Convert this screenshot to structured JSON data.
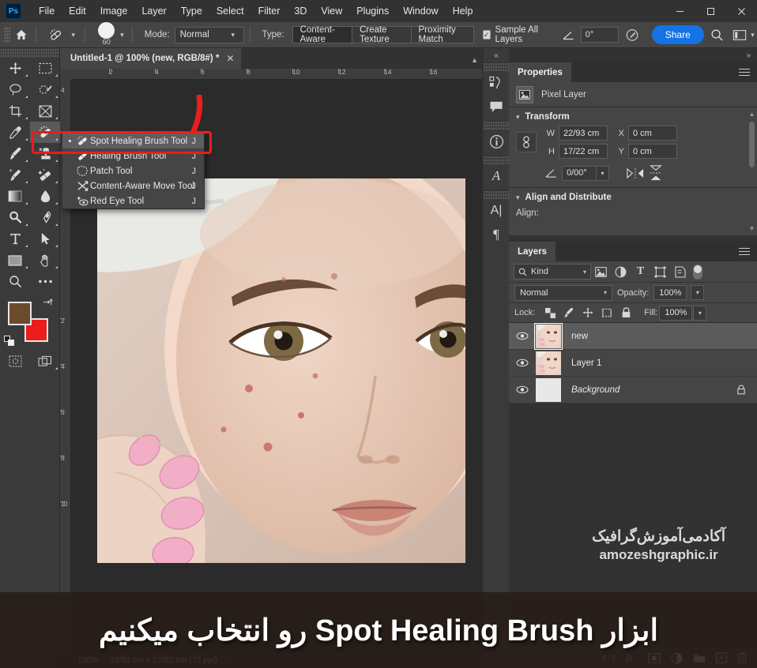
{
  "app": {
    "logo_text": "Ps"
  },
  "menubar": {
    "items": [
      "File",
      "Edit",
      "Image",
      "Layer",
      "Type",
      "Select",
      "Filter",
      "3D",
      "View",
      "Plugins",
      "Window",
      "Help"
    ]
  },
  "window_controls": {
    "minimize": "—",
    "maximize": "☐",
    "close": "✕"
  },
  "options_bar": {
    "home_icon": "home-icon",
    "tool_preset_icon": "spot-healing-brush-icon",
    "brush_size": "60",
    "mode_label": "Mode:",
    "mode_value": "Normal",
    "type_label": "Type:",
    "type_options": [
      "Content-Aware",
      "Create Texture",
      "Proximity Match"
    ],
    "type_active": "Content-Aware",
    "sample_all_layers_label": "Sample All Layers",
    "sample_all_layers_checked": true,
    "angle_value": "0°",
    "share_label": "Share",
    "search_icon": "search-icon",
    "workspace_icon": "workspace-icon"
  },
  "toolbar": {
    "tools": [
      "move-tool",
      "rectangular-marquee-tool",
      "lasso-tool",
      "object-selection-tool",
      "crop-tool",
      "frame-tool",
      "eyedropper-tool",
      "spot-healing-brush-tool",
      "brush-tool",
      "clone-stamp-tool",
      "history-brush-tool",
      "eraser-tool",
      "gradient-tool",
      "blur-tool",
      "dodge-tool",
      "pen-tool",
      "type-tool",
      "path-selection-tool",
      "rectangle-tool",
      "hand-tool",
      "zoom-tool",
      "more-tools"
    ],
    "selected_tool": "spot-healing-brush-tool",
    "foreground_color": "#6b4a2d",
    "background_color": "#ee1c1c",
    "bottom_tools": [
      "quick-mask-tool",
      "screen-mode-tool"
    ]
  },
  "flyout_menu": {
    "items": [
      {
        "label": "Spot Healing Brush Tool",
        "shortcut": "J",
        "icon": "spot-healing-brush-icon",
        "active": true,
        "bullet": "▪"
      },
      {
        "label": "Healing Brush Tool",
        "shortcut": "J",
        "icon": "healing-brush-icon",
        "active": false,
        "bullet": ""
      },
      {
        "label": "Patch Tool",
        "shortcut": "J",
        "icon": "patch-icon",
        "active": false,
        "bullet": ""
      },
      {
        "label": "Content-Aware Move Tool",
        "shortcut": "J",
        "icon": "content-aware-move-icon",
        "active": false,
        "bullet": ""
      },
      {
        "label": "Red Eye Tool",
        "shortcut": "J",
        "icon": "red-eye-icon",
        "active": false,
        "bullet": ""
      }
    ],
    "highlight_color": "#ef1b1b"
  },
  "document": {
    "tab_title": "Untitled-1 @ 100% (new, RGB/8#) *",
    "close_icon": "✕",
    "ruler_h_labels": [
      "2",
      "4",
      "6",
      "8",
      "10",
      "12",
      "14",
      "16"
    ],
    "ruler_v_labels": [
      "2",
      "4",
      "6",
      "8",
      "10"
    ]
  },
  "icon_dock": {
    "collapse_icon": "«",
    "items": [
      "actions-icon",
      "comments-icon",
      "info-icon",
      "glyphs-icon",
      "character-icon",
      "paragraph-icon"
    ]
  },
  "properties_panel": {
    "tab_label": "Properties",
    "menu_icon": "panel-menu-icon",
    "layer_type": "Pixel Layer",
    "layer_type_icon": "pixel-layer-icon",
    "transform": {
      "section_title": "Transform",
      "link_icon": "link-icon",
      "w_label": "W",
      "w_value": "22/93 cm",
      "h_label": "H",
      "h_value": "17/22 cm",
      "x_label": "X",
      "x_value": "0 cm",
      "y_label": "Y",
      "y_value": "0 cm",
      "angle_value": "0/00°",
      "flip_h_icon": "flip-horizontal-icon",
      "flip_v_icon": "flip-vertical-icon"
    },
    "align": {
      "section_title": "Align and Distribute",
      "align_label": "Align:"
    }
  },
  "layers_panel": {
    "tab_label": "Layers",
    "menu_icon": "panel-menu-icon",
    "filter": {
      "search_icon": "search-icon",
      "kind_label": "Kind",
      "icons": [
        "filter-pixel-icon",
        "filter-adjustment-icon",
        "filter-type-icon",
        "filter-shape-icon",
        "filter-smart-object-icon"
      ],
      "toggle": "filter-toggle"
    },
    "blend_mode": "Normal",
    "opacity_label": "Opacity:",
    "opacity_value": "100%",
    "lock_label": "Lock:",
    "lock_icons": [
      "lock-transparency-icon",
      "lock-image-icon",
      "lock-position-icon",
      "lock-artboard-icon",
      "lock-all-icon"
    ],
    "fill_label": "Fill:",
    "fill_value": "100%",
    "layers": [
      {
        "name": "new",
        "visible": true,
        "selected": true,
        "locked": false,
        "thumb": "photo",
        "italic": false
      },
      {
        "name": "Layer 1",
        "visible": true,
        "selected": false,
        "locked": false,
        "thumb": "photo",
        "italic": false
      },
      {
        "name": "Background",
        "visible": true,
        "selected": false,
        "locked": true,
        "thumb": "white",
        "italic": true
      }
    ],
    "action_icons": [
      "link-layers-icon",
      "layer-style-icon",
      "layer-mask-icon",
      "adjustment-layer-icon",
      "new-group-icon",
      "new-layer-icon",
      "delete-layer-icon"
    ]
  },
  "status_bar": {
    "zoom": "100%",
    "dimensions": "22/93 cm x 17/22 cm (72 ppi)",
    "arrow": "›"
  },
  "watermark": {
    "line1": "آکادمی‌آموزش‌گرافیک",
    "line2": "amozeshgraphic.ir"
  },
  "caption": {
    "text_rtl_before": "ابزار",
    "text_en": "Spot Healing Brush",
    "text_rtl_after": "رو انتخاب میکنیم"
  }
}
